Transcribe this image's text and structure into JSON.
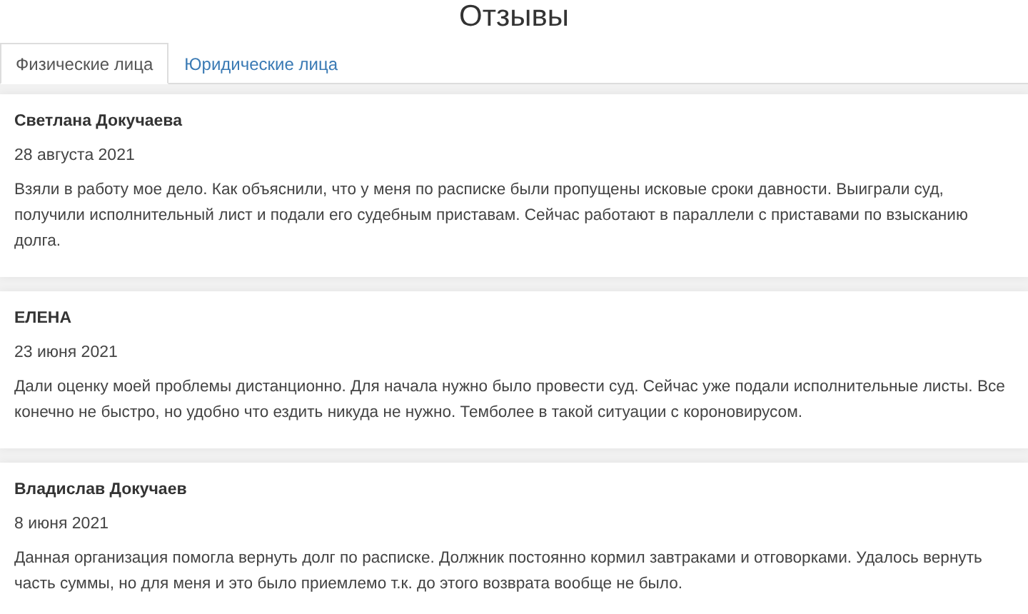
{
  "page_title": "Отзывы",
  "tabs": [
    {
      "label": "Физические лица",
      "selected": true
    },
    {
      "label": "Юридические лица",
      "selected": false
    }
  ],
  "reviews": [
    {
      "author": "Светлана Докучаева",
      "date": "28 августа 2021",
      "text": "Взяли в работу мое дело. Как объяснили, что у меня по расписке были пропущены исковые сроки давности. Выиграли суд, получили исполнительный лист и подали его судебным приставам. Сейчас работают в параллели с приставами по взысканию долга."
    },
    {
      "author": "ЕЛЕНА",
      "date": "23 июня 2021",
      "text": "Дали оценку моей проблемы дистанционно. Для начала нужно было провести суд. Сейчас уже подали исполнительные листы. Все конечно не быстро, но удобно что ездить никуда не нужно. Темболее в такой ситуации с короновирусом."
    },
    {
      "author": "Владислав Докучаев",
      "date": "8 июня 2021",
      "text": "Данная организация помогла вернуть долг по расписке. Должник постоянно кормил завтраками и отговорками. Удалось вернуть часть суммы, но для меня и это было приемлемо т.к. до этого возврата вообще не было."
    }
  ]
}
